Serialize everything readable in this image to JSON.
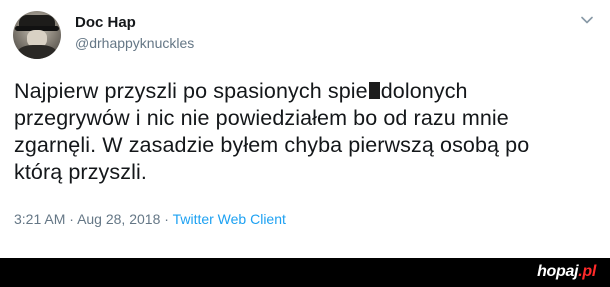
{
  "tweet": {
    "author": {
      "name": "Doc Hap",
      "handle": "@drhappyknuckles"
    },
    "text_lines": [
      [
        "Najpierw przyszli po spasionych spie",
        "dolonych"
      ],
      "przegrywów i nic nie powiedziałem bo od razu mnie",
      "zgarnęli. W zasadzie byłem chyba pierwszą osobą po",
      "którą przyszli."
    ],
    "time": "3:21 AM",
    "date": "Aug 28, 2018",
    "separator": "·",
    "client": "Twitter Web Client"
  },
  "icons": {
    "menu": "chevron-down-icon",
    "avatar": "profile-avatar"
  },
  "watermark": {
    "text": "hopaj",
    "suffix": ".pl"
  },
  "colors": {
    "text": "#14171a",
    "secondary": "#657786",
    "link": "#1da1f2",
    "bar": "#000000",
    "watermark_accent": "#ff2a2a"
  }
}
